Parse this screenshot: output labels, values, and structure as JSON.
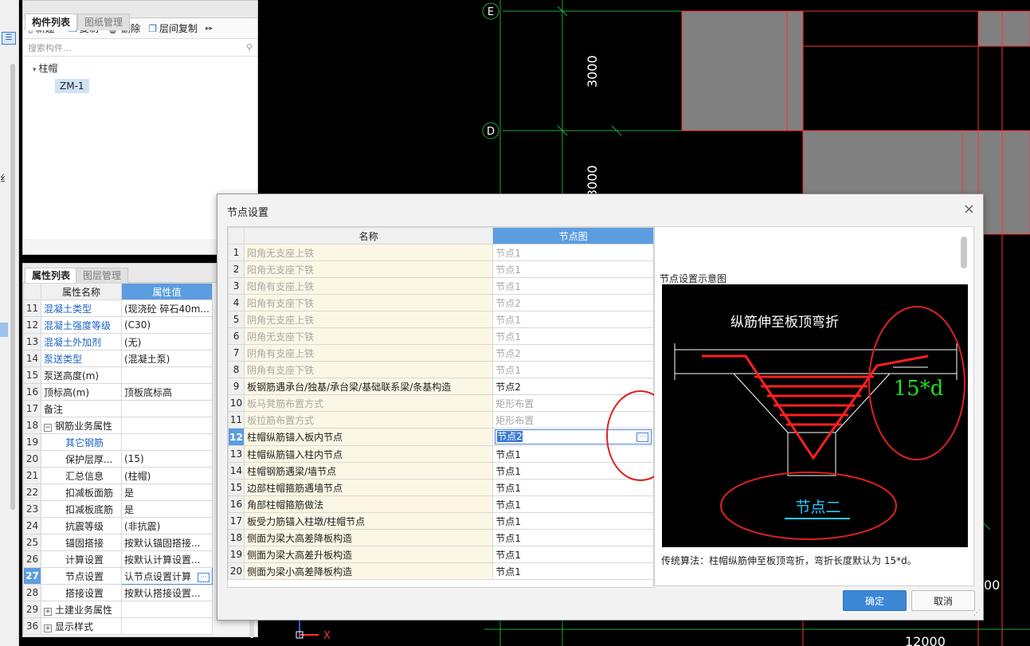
{
  "left_panel": {
    "tabs": [
      "构件列表",
      "图纸管理"
    ],
    "toolbar": {
      "new": "新建",
      "copy": "复制",
      "delete": "删除",
      "floor_copy": "层间复制"
    },
    "search_placeholder": "搜索构件...",
    "tree": {
      "category": "柱帽",
      "item": "ZM-1"
    }
  },
  "props_panel": {
    "tabs": [
      "属性列表",
      "图层管理"
    ],
    "headers": {
      "name": "属性名称",
      "value": "属性值"
    },
    "rows": [
      {
        "num": "11",
        "name": "混凝土类型",
        "value": "(现浇砼 碎石40m..."
      },
      {
        "num": "12",
        "name": "混凝土强度等级",
        "value": "(C30)"
      },
      {
        "num": "13",
        "name": "混凝土外加剂",
        "value": "(无)"
      },
      {
        "num": "14",
        "name": "泵送类型",
        "value": "(混凝土泵)"
      },
      {
        "num": "15",
        "name": "泵送高度(m)",
        "value": ""
      },
      {
        "num": "16",
        "name": "顶标高(m)",
        "value": "顶板底标高"
      },
      {
        "num": "17",
        "name": "备注",
        "value": ""
      },
      {
        "num": "18",
        "name": "钢筋业务属性",
        "value": ""
      },
      {
        "num": "19",
        "name": "其它钢筋",
        "value": ""
      },
      {
        "num": "20",
        "name": "保护层厚...",
        "value": "(15)"
      },
      {
        "num": "21",
        "name": "汇总信息",
        "value": "(柱帽)"
      },
      {
        "num": "22",
        "name": "扣减板面筋",
        "value": "是"
      },
      {
        "num": "23",
        "name": "扣减板底筋",
        "value": "是"
      },
      {
        "num": "24",
        "name": "抗震等级",
        "value": "(非抗震)"
      },
      {
        "num": "25",
        "name": "锚固搭接",
        "value": "按默认锚固搭接..."
      },
      {
        "num": "26",
        "name": "计算设置",
        "value": "按默认计算设置..."
      },
      {
        "num": "27",
        "name": "节点设置",
        "value": "认节点设置计算"
      },
      {
        "num": "28",
        "name": "搭接设置",
        "value": "按默认搭接设置..."
      },
      {
        "num": "29",
        "name": "土建业务属性",
        "value": ""
      },
      {
        "num": "36",
        "name": "显示样式",
        "value": ""
      }
    ]
  },
  "cad": {
    "axis_labels": [
      "E",
      "D"
    ],
    "dims": [
      "3000",
      "3000",
      "12000",
      "00"
    ],
    "x_axis": "X"
  },
  "dialog": {
    "title": "节点设置",
    "headers": {
      "name": "名称",
      "value": "节点图"
    },
    "rows": [
      {
        "num": "1",
        "name": "阳角无支座上铁",
        "value": "节点1",
        "enabled": false
      },
      {
        "num": "2",
        "name": "阳角无支座下铁",
        "value": "节点1",
        "enabled": false
      },
      {
        "num": "3",
        "name": "阳角有支座上铁",
        "value": "节点1",
        "enabled": false
      },
      {
        "num": "4",
        "name": "阳角有支座下铁",
        "value": "节点2",
        "enabled": false
      },
      {
        "num": "5",
        "name": "阴角无支座上铁",
        "value": "节点1",
        "enabled": false
      },
      {
        "num": "6",
        "name": "阴角无支座下铁",
        "value": "节点1",
        "enabled": false
      },
      {
        "num": "7",
        "name": "阴角有支座上铁",
        "value": "节点2",
        "enabled": false
      },
      {
        "num": "8",
        "name": "阴角有支座下铁",
        "value": "节点1",
        "enabled": false
      },
      {
        "num": "9",
        "name": "板钢筋遇承台/独基/承台梁/基础联系梁/条基构造",
        "value": "节点2",
        "enabled": true
      },
      {
        "num": "10",
        "name": "板马凳筋布置方式",
        "value": "矩形布置",
        "enabled": false
      },
      {
        "num": "11",
        "name": "板拉筋布置方式",
        "value": "矩形布置",
        "enabled": false
      },
      {
        "num": "12",
        "name": "柱帽纵筋锚入板内节点",
        "value": "节点2",
        "enabled": true
      },
      {
        "num": "13",
        "name": "柱帽纵筋锚入柱内节点",
        "value": "节点1",
        "enabled": true
      },
      {
        "num": "14",
        "name": "柱帽钢筋遇梁/墙节点",
        "value": "节点1",
        "enabled": true
      },
      {
        "num": "15",
        "name": "边部柱帽箍筋遇墙节点",
        "value": "节点1",
        "enabled": true
      },
      {
        "num": "16",
        "name": "角部柱帽箍筋做法",
        "value": "节点1",
        "enabled": true
      },
      {
        "num": "17",
        "name": "板受力筋锚入柱墩/柱帽节点",
        "value": "节点1",
        "enabled": true
      },
      {
        "num": "18",
        "name": "侧面为梁大高差降板构造",
        "value": "节点1",
        "enabled": true
      },
      {
        "num": "19",
        "name": "侧面为梁大高差升板构造",
        "value": "节点1",
        "enabled": true
      },
      {
        "num": "20",
        "name": "侧面为梁小高差降板构造",
        "value": "节点1",
        "enabled": true
      }
    ],
    "preview": {
      "label": "节点设置示意图",
      "diagram_title": "纵筋伸至板顶弯折",
      "annotation": "15*d",
      "node_name": "节点二",
      "description": "传统算法：柱帽纵筋伸至板顶弯折，弯折长度默认为 15*d。"
    },
    "buttons": {
      "ok": "确定",
      "cancel": "取消"
    }
  }
}
